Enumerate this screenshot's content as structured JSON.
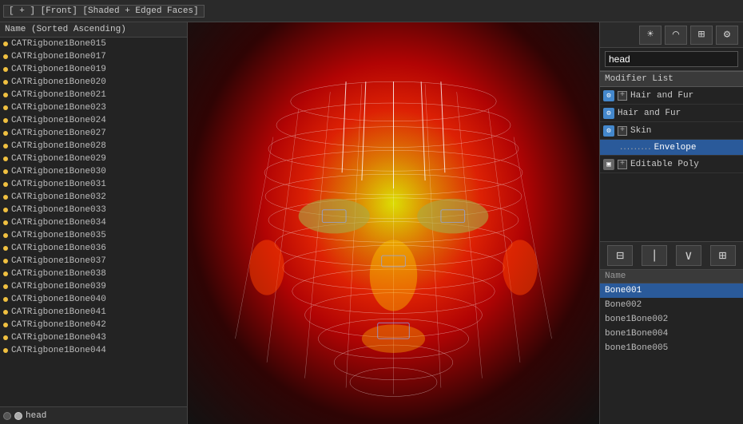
{
  "topbar": {
    "label": "[ + ] [Front] [Shaded + Edged Faces]"
  },
  "left_panel": {
    "header": "Name (Sorted Ascending)",
    "items": [
      "CATRigbone1Bone015",
      "CATRigbone1Bone017",
      "CATRigbone1Bone019",
      "CATRigbone1Bone020",
      "CATRigbone1Bone021",
      "CATRigbone1Bone023",
      "CATRigbone1Bone024",
      "CATRigbone1Bone027",
      "CATRigbone1Bone028",
      "CATRigbone1Bone029",
      "CATRigbone1Bone030",
      "CATRigbone1Bone031",
      "CATRigbone1Bone032",
      "CATRigbone1Bone033",
      "CATRigbone1Bone034",
      "CATRigbone1Bone035",
      "CATRigbone1Bone036",
      "CATRigbone1Bone037",
      "CATRigbone1Bone038",
      "CATRigbone1Bone039",
      "CATRigbone1Bone040",
      "CATRigbone1Bone041",
      "CATRigbone1Bone042",
      "CATRigbone1Bone043",
      "CATRigbone1Bone044"
    ],
    "status": "head"
  },
  "right_panel": {
    "name_field": "head",
    "modifier_list_label": "Modifier List",
    "modifiers": [
      {
        "id": "hair1",
        "label": "Hair and Fur",
        "has_plus": true,
        "type": "gear"
      },
      {
        "id": "hair2",
        "label": "Hair and Fur",
        "has_plus": false,
        "type": "gear"
      },
      {
        "id": "skin",
        "label": "Skin",
        "has_plus": true,
        "type": "gear"
      },
      {
        "id": "envelope",
        "label": "Envelope",
        "selected": true,
        "is_child": true
      },
      {
        "id": "editable",
        "label": "Editable Poly",
        "has_plus": true,
        "type": "box"
      }
    ],
    "nav_buttons": [
      "⊟",
      "|",
      "∨",
      "⊞"
    ],
    "bottom_header": "Name",
    "bones": [
      {
        "label": "Bone001",
        "selected": true
      },
      {
        "label": "Bone002",
        "selected": false
      },
      {
        "label": "bone1Bone002",
        "selected": false
      },
      {
        "label": "bone1Bone004",
        "selected": false
      },
      {
        "label": "bone1Bone005",
        "selected": false
      }
    ]
  },
  "toolbar_icons": [
    "☀",
    "◌",
    "⬡",
    "⚙"
  ]
}
